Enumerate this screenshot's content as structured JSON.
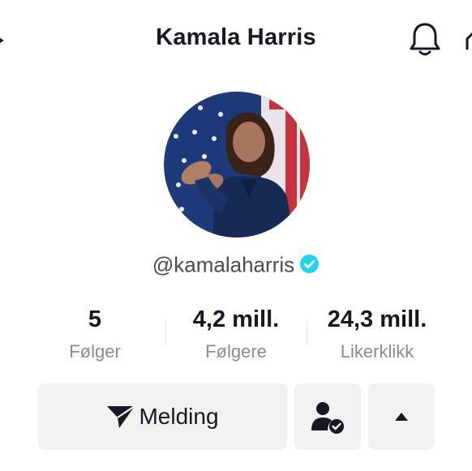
{
  "header": {
    "title": "Kamala Harris"
  },
  "profile": {
    "handle": "@kamalaharris",
    "verified": true
  },
  "stats": [
    {
      "value": "5",
      "label": "Følger"
    },
    {
      "value": "4,2 mill.",
      "label": "Følgere"
    },
    {
      "value": "24,3 mill.",
      "label": "Likerklikk"
    }
  ],
  "actions": {
    "message_label": "Melding"
  },
  "icons": {
    "back": "back-arrow-icon",
    "notifications": "bell-icon",
    "share": "share-icon",
    "verified": "verified-badge-icon",
    "message": "send-icon",
    "friend": "user-check-icon",
    "more": "caret-up-icon"
  },
  "colors": {
    "verified": "#20d5ec",
    "button_bg": "#f1f1f2",
    "text_primary": "#161823",
    "text_secondary": "#8a8b91"
  }
}
